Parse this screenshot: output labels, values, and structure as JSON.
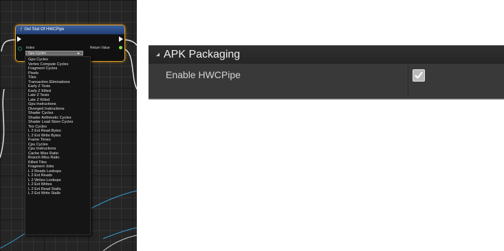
{
  "graph": {
    "node_title": "Get Stat Of HWCPipe",
    "node_title_icon": "function-icon",
    "index_label": "Index",
    "return_label": "Return Value",
    "index_selected": "Gpu Cycles",
    "dropdown_options": [
      "Gpu Cycles",
      "Vertex Compute Cycles",
      "Fragment Cycles",
      "Pixels",
      "Tiles",
      "Transaction Eliminations",
      "Early Z Tests",
      "Early Z Killed",
      "Late Z Tests",
      "Late Z Killed",
      "Gpu Instructions",
      "Diverged Instructions",
      "Shader Cycles",
      "Shader Arithmetic Cycles",
      "Shader Load Store Cycles",
      "Tex Cycles",
      "L 2 Ext Read Bytes",
      "L 2 Ext Write Bytes",
      "Frame Times",
      "Cpu Cycles",
      "Cpu Instructions",
      "Cache Miss Ratio",
      "Branch Miss Ratio",
      "Killed Tiles",
      "Fragment Jobs",
      "L 2 Reads Lookups",
      "L 2 Ext Reads",
      "L 2 Writes Lookups",
      "L 2 Ext Writes",
      "L 2 Ext Read Stalls",
      "L 2 Ext Write Stalls"
    ],
    "colors": {
      "node_border": "#e8a524",
      "header": "#2c4f8a",
      "byte_pin": "#1e8a5a",
      "return_pin": "#8be04a",
      "wire_white": "#e6e6e6",
      "wire_blue": "#3aa0d8"
    }
  },
  "settings": {
    "category": "APK Packaging",
    "category_icon": "collapse-triangle-icon",
    "property_label": "Enable HWCPipe",
    "property_checked": true,
    "check_icon": "checkmark-icon"
  }
}
